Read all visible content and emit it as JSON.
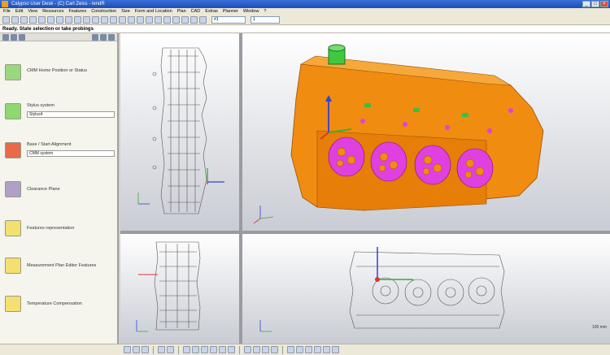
{
  "window": {
    "title": "Calypso User Desk - (C) Carl Zeiss - lendR"
  },
  "menu": [
    "File",
    "Edit",
    "View",
    "Resources",
    "Features",
    "Construction",
    "Size",
    "Form and Location",
    "Plan",
    "CAD",
    "Extras",
    "Planner",
    "Window",
    "?"
  ],
  "toolbar": {
    "combo_value": "#1",
    "combo_value2": "1"
  },
  "status": {
    "text": "Ready. State selection or take probings"
  },
  "leftpane": {
    "items": [
      {
        "label": "CMM Home Position or Status",
        "icon": "cmm-home-icon",
        "field": ""
      },
      {
        "label": "Stylus system",
        "icon": "stylus-icon",
        "field": "Stylus4"
      },
      {
        "label": "Base / Start Alignment",
        "icon": "alignment-icon",
        "field": "CMM system"
      },
      {
        "label": "Clearance Plane",
        "icon": "clearance-plane-icon",
        "field": ""
      },
      {
        "label": "Features representation",
        "icon": "features-icon",
        "field": ""
      },
      {
        "label": "Measurement Plan Editor Features",
        "icon": "plan-editor-icon",
        "field": ""
      },
      {
        "label": "Temperature Compensation",
        "icon": "temperature-icon",
        "field": ""
      }
    ]
  },
  "viewport": {
    "scale_label": "100 mm"
  },
  "colors": {
    "part": "#f08c10",
    "bore": "#e040e0",
    "accent": "#3ac040",
    "axis_x": "#e03030",
    "axis_y": "#30b030",
    "axis_z": "#3040e0"
  }
}
